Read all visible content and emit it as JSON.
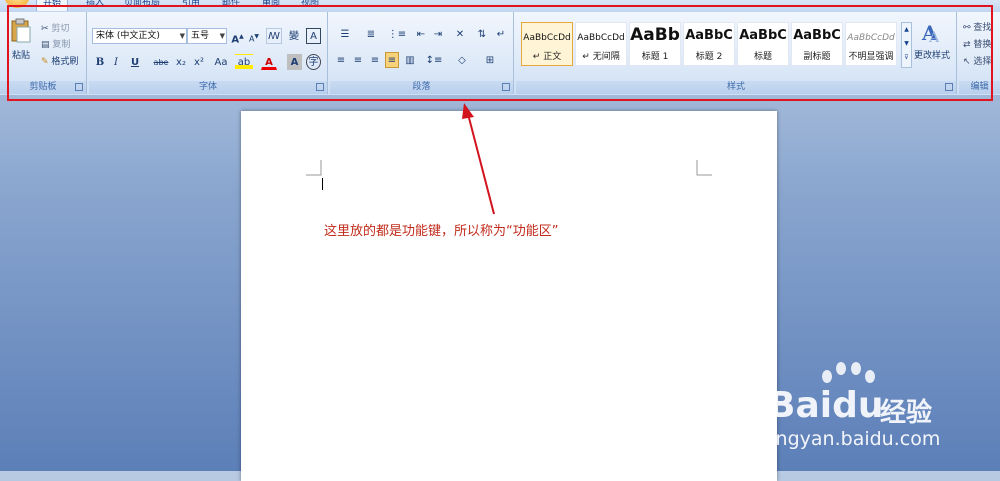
{
  "tabs": [
    {
      "label": "开始",
      "active": true
    },
    {
      "label": "插入"
    },
    {
      "label": "页面布局"
    },
    {
      "label": "引用"
    },
    {
      "label": "邮件"
    },
    {
      "label": "审阅"
    },
    {
      "label": "视图"
    }
  ],
  "clipboard": {
    "paste": "粘贴",
    "cut": "剪切",
    "copy": "复制",
    "format_painter": "格式刷",
    "label": "剪贴板"
  },
  "font": {
    "family": "宋体 (中文正文)",
    "size": "五号",
    "grow": "A",
    "shrink": "A",
    "phonetic": "變",
    "char_border": "A",
    "bold": "B",
    "italic": "I",
    "underline": "U",
    "strikethrough": "abe",
    "subscript": "x₂",
    "superscript": "x²",
    "change_case": "Aa",
    "highlight": "ab",
    "font_color": "A",
    "char_shading": "A",
    "enclose": "字",
    "label": "字体"
  },
  "paragraph": {
    "label": "段落"
  },
  "styles": {
    "label": "样式",
    "change_styles": "更改样式",
    "items": [
      {
        "sample": "AaBbCcDd",
        "name": "↵ 正文"
      },
      {
        "sample": "AaBbCcDd",
        "name": "↵ 无间隔"
      },
      {
        "sample": "AaBb",
        "name": "标题 1"
      },
      {
        "sample": "AaBbC",
        "name": "标题 2"
      },
      {
        "sample": "AaBbC",
        "name": "标题"
      },
      {
        "sample": "AaBbC",
        "name": "副标题"
      },
      {
        "sample": "AaBbCcDd",
        "name": "不明显强调"
      }
    ]
  },
  "editing": {
    "find": "查找",
    "replace": "替换",
    "select": "选择",
    "label": "编辑"
  },
  "annotation": "这里放的都是功能键，所以称为“功能区”",
  "watermark": {
    "logo": "Bai",
    "logo_tail": "du",
    "brand_cn": "经验",
    "url": "jingyan.baidu.com"
  },
  "colors": {
    "highlight_border": "#e0141e",
    "annotation_text": "#c22b1b",
    "arrow": "#d2141e"
  }
}
